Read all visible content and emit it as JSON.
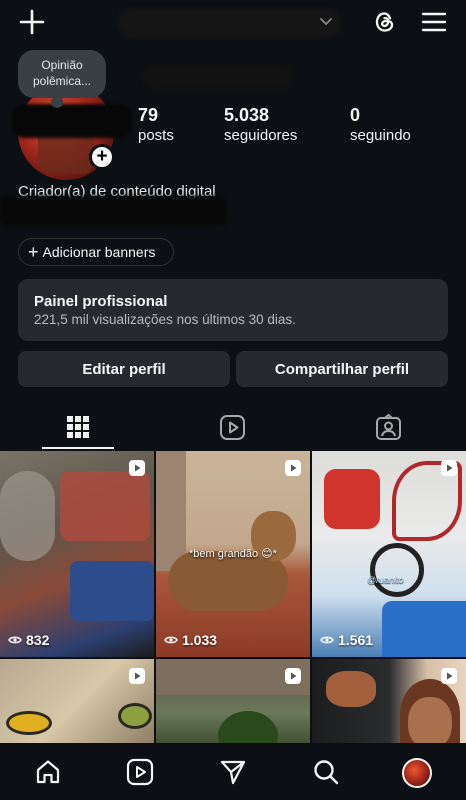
{
  "header": {
    "create_icon": "plus-icon",
    "threads_icon": "threads-icon",
    "menu_icon": "hamburger-menu-icon"
  },
  "profile": {
    "note": "Opinião polêmica...",
    "stats": [
      {
        "value": "79",
        "label": "posts"
      },
      {
        "value": "5.038",
        "label": "seguidores"
      },
      {
        "value": "0",
        "label": "seguindo"
      }
    ],
    "category": "Criador(a) de conteúdo digital",
    "add_banners": "Adicionar banners"
  },
  "pro_panel": {
    "title": "Painel profissional",
    "subtitle": "221,5 mil visualizações nos últimos 30 dias."
  },
  "buttons": {
    "edit": "Editar perfil",
    "share": "Compartilhar perfil"
  },
  "tabs": [
    {
      "icon": "grid-icon",
      "active": true
    },
    {
      "icon": "reels-icon",
      "active": false
    },
    {
      "icon": "tagged-icon",
      "active": false
    }
  ],
  "posts": [
    {
      "views": "832"
    },
    {
      "views": "1.033",
      "caption": "*bem grandão 😊*"
    },
    {
      "views": "1.561",
      "watermark": "@ruanito"
    },
    {
      "views": ""
    },
    {
      "views": ""
    },
    {
      "views": ""
    }
  ],
  "bottom_nav": [
    "home-icon",
    "reels-icon",
    "direct-icon",
    "search-icon",
    "profile-avatar"
  ],
  "colors": {
    "background": "#0c1014",
    "card": "#262a2f",
    "text": "#f5f5f5",
    "muted": "#b8bcc0"
  }
}
